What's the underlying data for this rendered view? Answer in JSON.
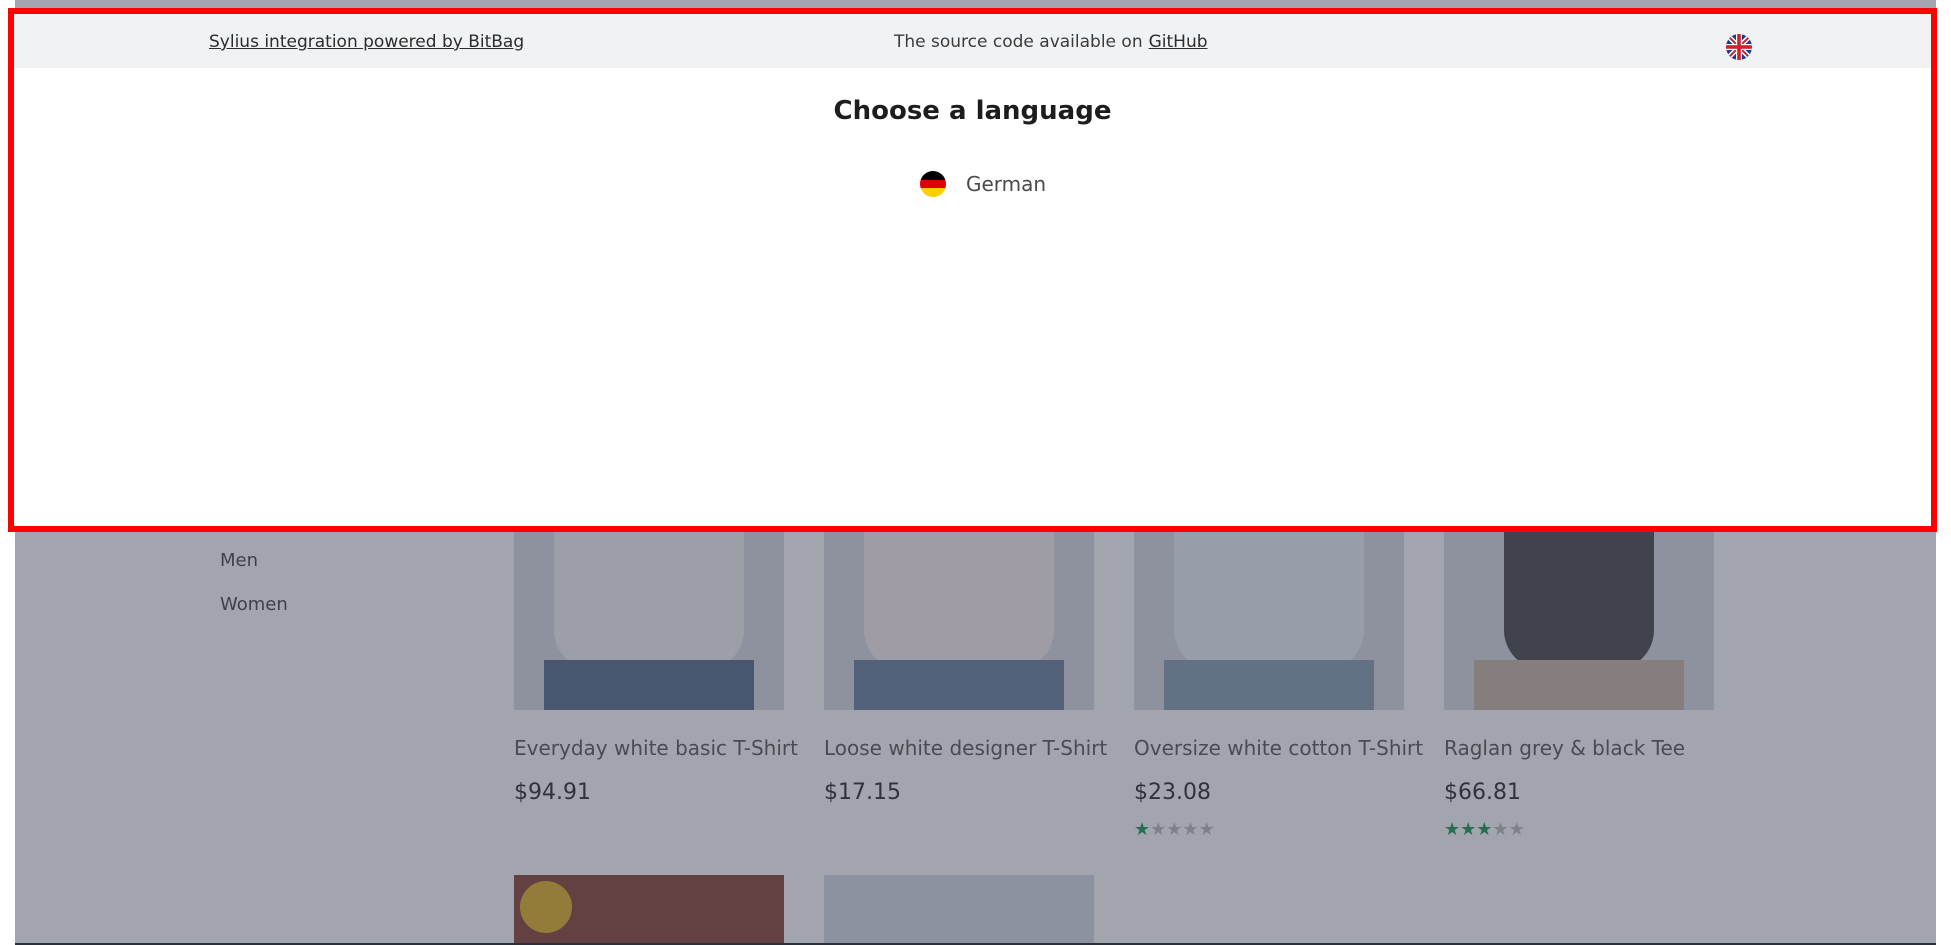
{
  "topbar": {
    "integration_text": "Sylius integration powered by BitBag",
    "source_text": "The source code available on",
    "github_label": "GitHub",
    "current_locale_icon": "uk-flag-icon"
  },
  "language_modal": {
    "title": "Choose a language",
    "options": [
      {
        "label": "German",
        "icon": "germany-flag-icon"
      }
    ]
  },
  "sidebar": {
    "items": [
      {
        "label": "Men"
      },
      {
        "label": "Women"
      }
    ]
  },
  "products": [
    {
      "name": "Everyday white basic T-Shirt",
      "price": "$94.91",
      "rating": null
    },
    {
      "name": "Loose white designer T-Shirt",
      "price": "$17.15",
      "rating": null
    },
    {
      "name": "Oversize white cotton T-Shirt",
      "price": "$23.08",
      "rating": 1
    },
    {
      "name": "Raglan grey & black Tee",
      "price": "$66.81",
      "rating": 3
    }
  ],
  "colors": {
    "modal_border": "#ff0000",
    "rating_star": "#1e9a5e",
    "overlay": "#32374b"
  }
}
